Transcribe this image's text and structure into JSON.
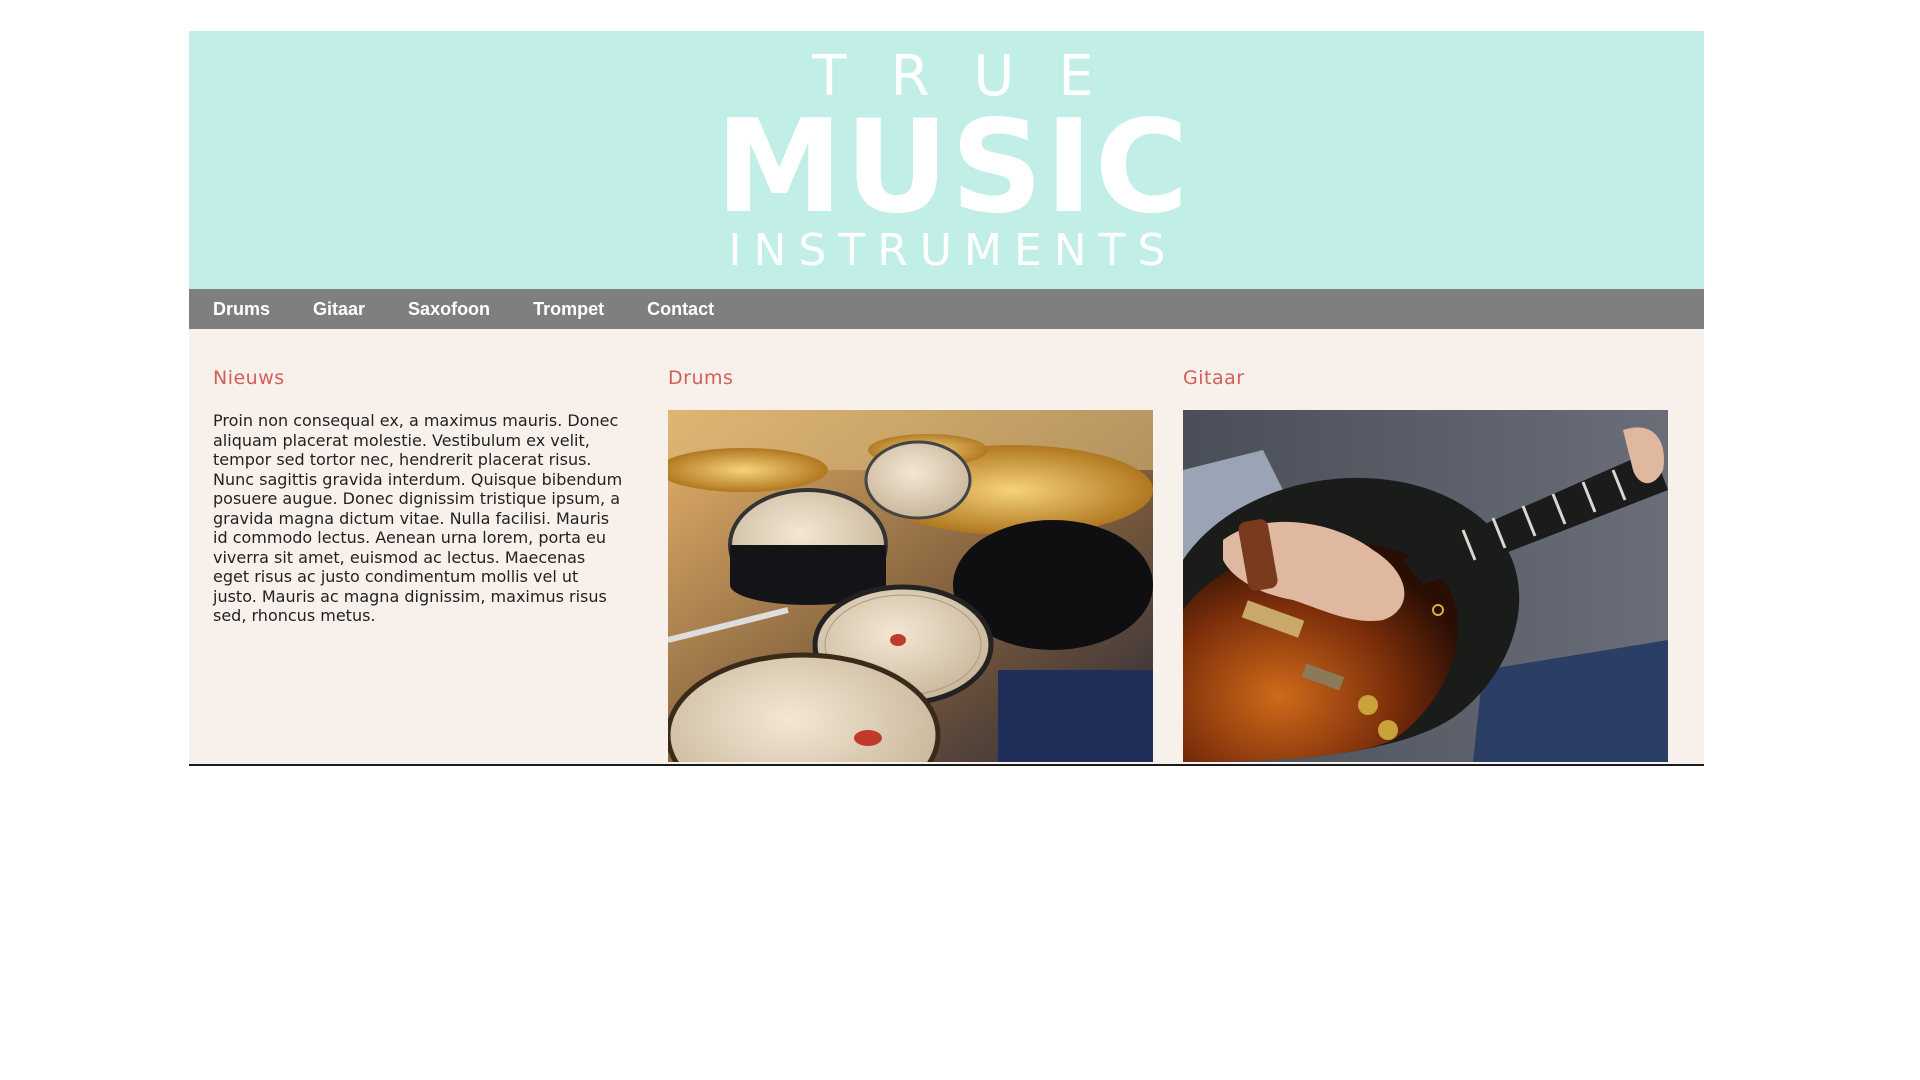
{
  "header": {
    "logo": {
      "line1": "TRUE",
      "line2": "MUSIC",
      "line3": "INSTRUMENTS"
    },
    "background": "#c1eee6"
  },
  "nav": {
    "items": [
      {
        "label": "Drums"
      },
      {
        "label": "Gitaar"
      },
      {
        "label": "Saxofoon"
      },
      {
        "label": "Trompet"
      },
      {
        "label": "Contact"
      }
    ],
    "background": "#7f7f7f"
  },
  "main": {
    "news": {
      "title": "Nieuws",
      "text": "Proin non consequal ex, a maximus mauris. Donec aliquam placerat molestie. Vestibulum ex velit, tempor sed tortor nec, hendrerit placerat risus. Nunc sagittis gravida interdum. Quisque bibendum posuere augue. Donec dignissim tristique ipsum, a gravida magna dictum vitae. Nulla facilisi. Mauris id commodo lectus. Aenean urna lorem, porta eu viverra sit amet, euismod ac lectus. Maecenas eget risus ac justo condimentum mollis vel ut justo. Mauris ac magna dignissim, maximus risus sed, rhoncus metus."
    },
    "drums": {
      "title": "Drums",
      "image": "drum-kit-photo"
    },
    "gitaar": {
      "title": "Gitaar",
      "image": "electric-guitar-photo"
    },
    "accent_color": "#d0605a",
    "background": "#f8f0eb"
  }
}
